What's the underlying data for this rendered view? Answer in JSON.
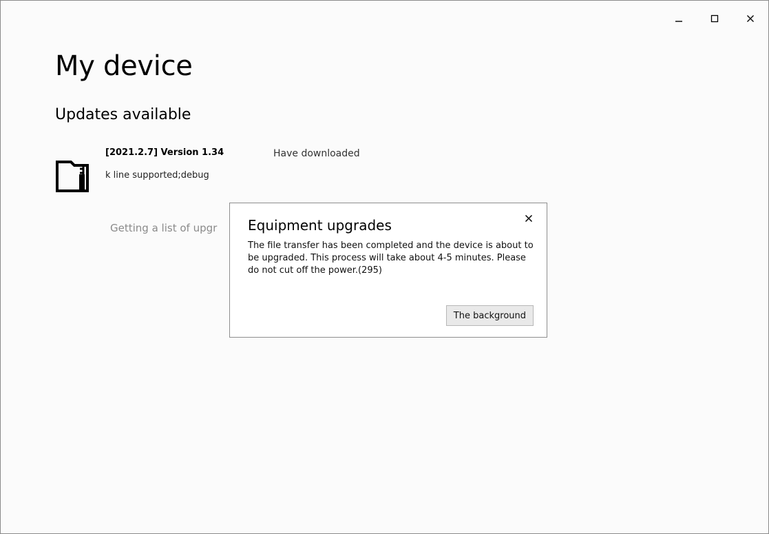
{
  "window": {
    "controls": {
      "minimize_icon": "minimize-icon",
      "maximize_icon": "maximize-icon",
      "close_icon": "close-icon"
    }
  },
  "page": {
    "title": "My device",
    "section_title": "Updates available"
  },
  "update": {
    "icon": "sd-card-icon",
    "version": "[2021.2.7] Version 1.34",
    "description": "k line supported;debug",
    "status": "Have downloaded"
  },
  "loading_text": "Getting a list of upgr",
  "dialog": {
    "title": "Equipment upgrades",
    "message": "The file transfer has been completed and the device is about to be upgraded. This process will take about 4-5 minutes. Please do not cut off the power.(295)",
    "button_label": "The background",
    "close_icon": "close-icon"
  },
  "colors": {
    "window_background": "#fbfbfb",
    "muted_text": "#8a8a8a",
    "button_background": "#e9e9e9"
  }
}
